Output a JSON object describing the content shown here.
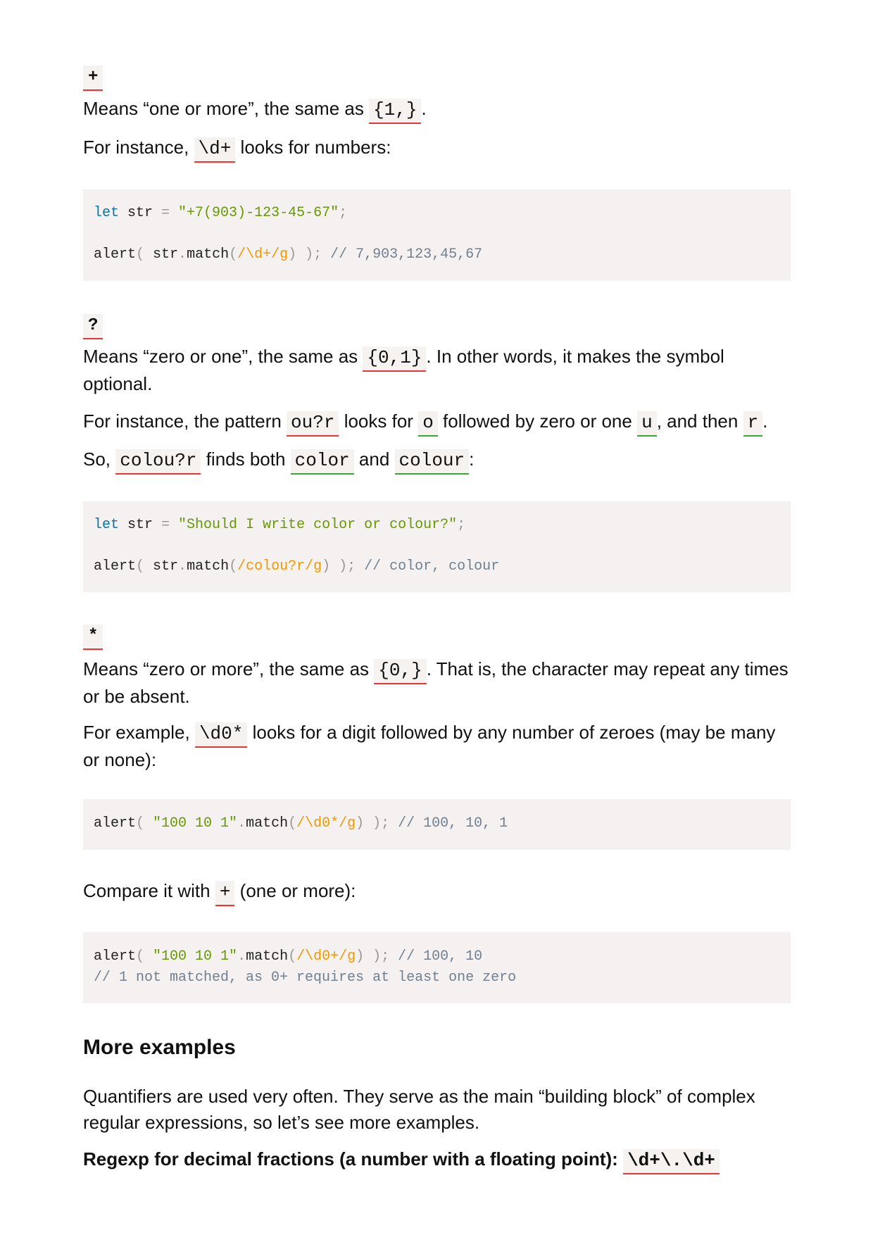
{
  "plus": {
    "tag": "+",
    "p1": [
      "Means “one or more”, the same as ",
      "{1,}",
      "."
    ],
    "p2": [
      "For instance, ",
      "\\d+",
      " looks for numbers:"
    ],
    "code": [
      [
        "let",
        " str ",
        "=",
        " \"+7(903)-123-45-67\"",
        ";"
      ],
      [
        "alert",
        "(",
        " str",
        ".",
        "match",
        "(",
        "/\\d+/g",
        ")",
        " );",
        " // 7,903,123,45,67"
      ]
    ]
  },
  "question": {
    "tag": "?",
    "p1": [
      "Means “zero or one”, the same as ",
      "{0,1}",
      ". In other words, it makes the symbol optional."
    ],
    "p2": [
      "For instance, the pattern ",
      "ou?r",
      " looks for ",
      "o",
      " followed by zero or one ",
      "u",
      ", and then ",
      "r",
      "."
    ],
    "p3": [
      "So, ",
      "colou?r",
      " finds both ",
      "color",
      " and ",
      "colour",
      ":"
    ],
    "code": [
      [
        "let",
        " str ",
        "=",
        " \"Should I write color or colour?\"",
        ";"
      ],
      [
        "alert",
        "(",
        " str",
        ".",
        "match",
        "(",
        "/colou?r/g",
        ")",
        " );",
        " // color, colour"
      ]
    ]
  },
  "star": {
    "tag": "*",
    "p1": [
      "Means “zero or more”, the same as ",
      "{0,}",
      ". That is, the character may repeat any times or be absent."
    ],
    "p2": [
      "For example, ",
      "\\d0*",
      " looks for a digit followed by any number of zeroes (may be many or none):"
    ],
    "code": [
      "alert",
      "(",
      " \"100 10 1\"",
      ".",
      "match",
      "(",
      "/\\d0*/g",
      ")",
      " );",
      " // 100, 10, 1"
    ],
    "compare": [
      "Compare it with ",
      "+",
      " (one or more):"
    ],
    "code2": [
      "alert",
      "(",
      " \"100 10 1\"",
      ".",
      "match",
      "(",
      "/\\d0+/g",
      ")",
      " );",
      " // 100, 10"
    ],
    "code2_comment": "// 1 not matched, as 0+ requires at least one zero"
  },
  "more": {
    "heading": "More examples",
    "p1": "Quantifiers are used very often. They serve as the main “building block” of complex regular expressions, so let’s see more examples.",
    "p2": [
      "Regexp for decimal fractions (a number with a floating point): ",
      "\\d+\\.\\d+"
    ]
  }
}
